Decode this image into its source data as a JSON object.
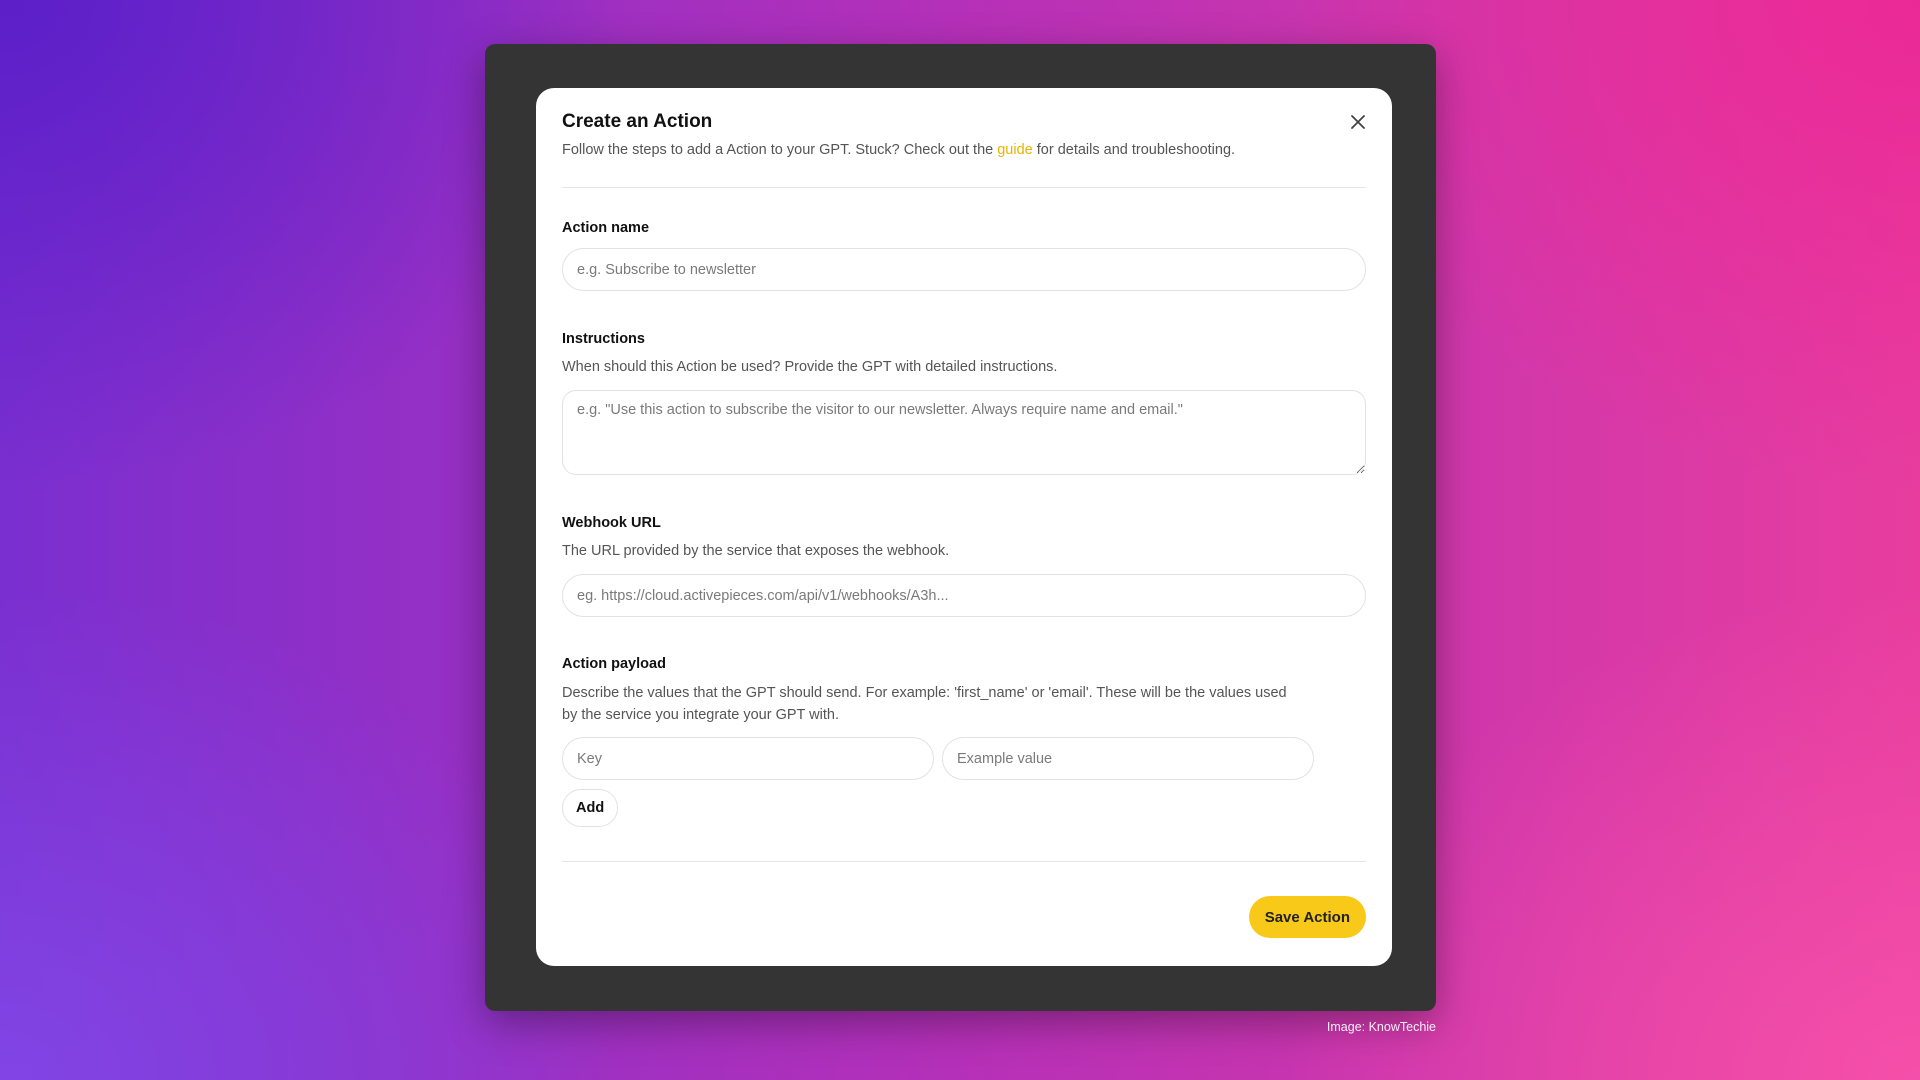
{
  "modal": {
    "title": "Create an Action",
    "subtitle_prefix": "Follow the steps to add a Action to your GPT. Stuck? Check out the ",
    "subtitle_link": "guide",
    "subtitle_suffix": " for details and troubleshooting.",
    "accent_color": "#f9c919",
    "link_color": "#e8b400"
  },
  "action_name": {
    "label": "Action name",
    "placeholder": "e.g. Subscribe to newsletter",
    "value": ""
  },
  "instructions": {
    "label": "Instructions",
    "help": "When should this Action be used? Provide the GPT with detailed instructions.",
    "placeholder": "e.g. \"Use this action to subscribe the visitor to our newsletter. Always require name and email.\"",
    "value": ""
  },
  "webhook": {
    "label": "Webhook URL",
    "help": "The URL provided by the service that exposes the webhook.",
    "placeholder": "eg. https://cloud.activepieces.com/api/v1/webhooks/A3h...",
    "value": ""
  },
  "payload": {
    "label": "Action payload",
    "help_line1": "Describe the values that the GPT should send. For example: 'first_name' or 'email'. These will be the values used",
    "help_line2": "by the service you integrate your GPT with.",
    "key_placeholder": "Key",
    "value_placeholder": "Example value",
    "add_label": "Add"
  },
  "footer": {
    "save_label": "Save Action"
  },
  "close_icon": "close-icon",
  "credit": "Image: KnowTechie"
}
